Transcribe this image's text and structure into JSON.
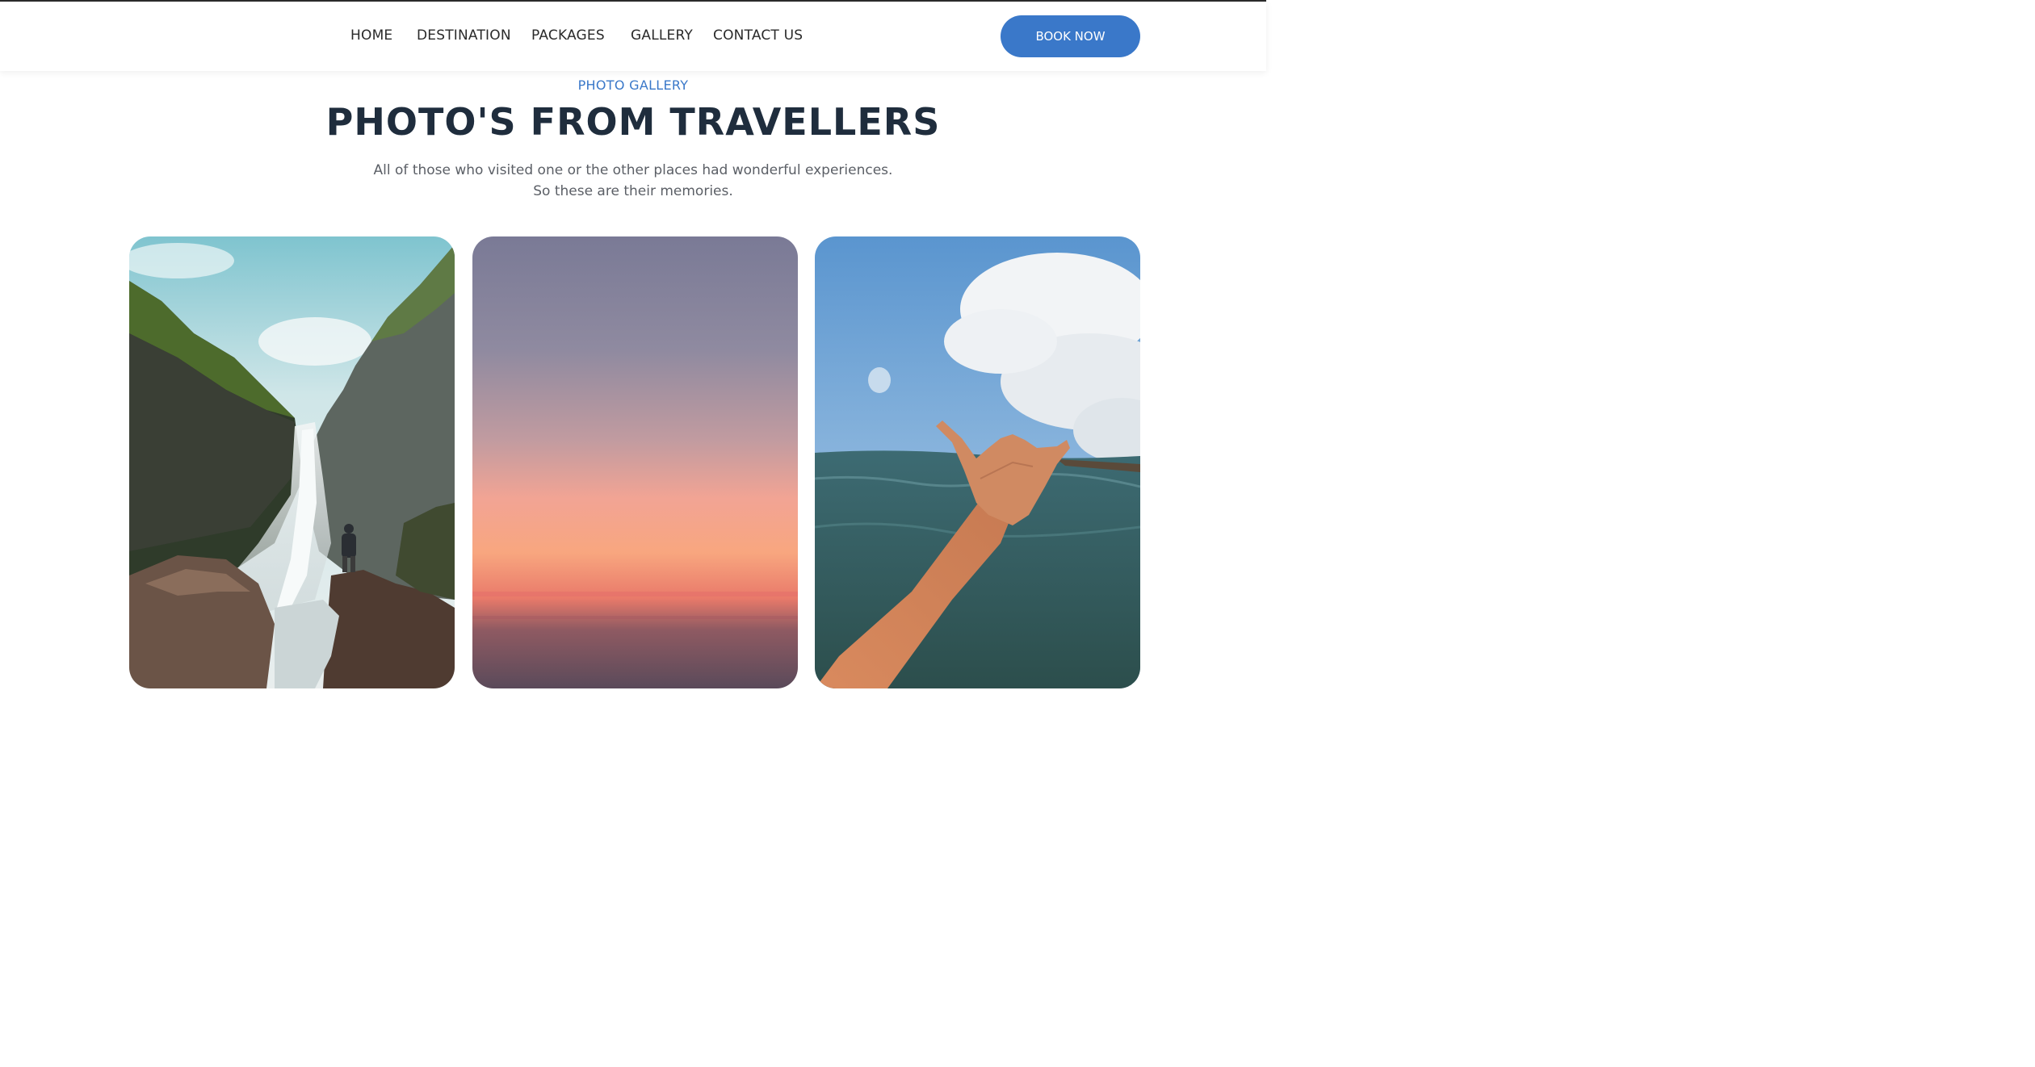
{
  "nav": {
    "items": [
      "HOME",
      "DESTINATION",
      "PACKAGES",
      "GALLERY",
      "CONTACT US"
    ],
    "cta": "BOOK NOW"
  },
  "section": {
    "eyebrow": "PHOTO GALLERY",
    "title": "PHOTO'S FROM TRAVELLERS",
    "subtitle_line1": "All of those who visited one or the other places had wonderful experiences.",
    "subtitle_line2": "So these are their memories."
  },
  "colors": {
    "accent": "#3a78c9",
    "heading": "#1f2d3d",
    "text": "#5b5f66"
  },
  "gallery": [
    "waterfall-photo",
    "sunset-photo",
    "ocean-hand-photo"
  ]
}
